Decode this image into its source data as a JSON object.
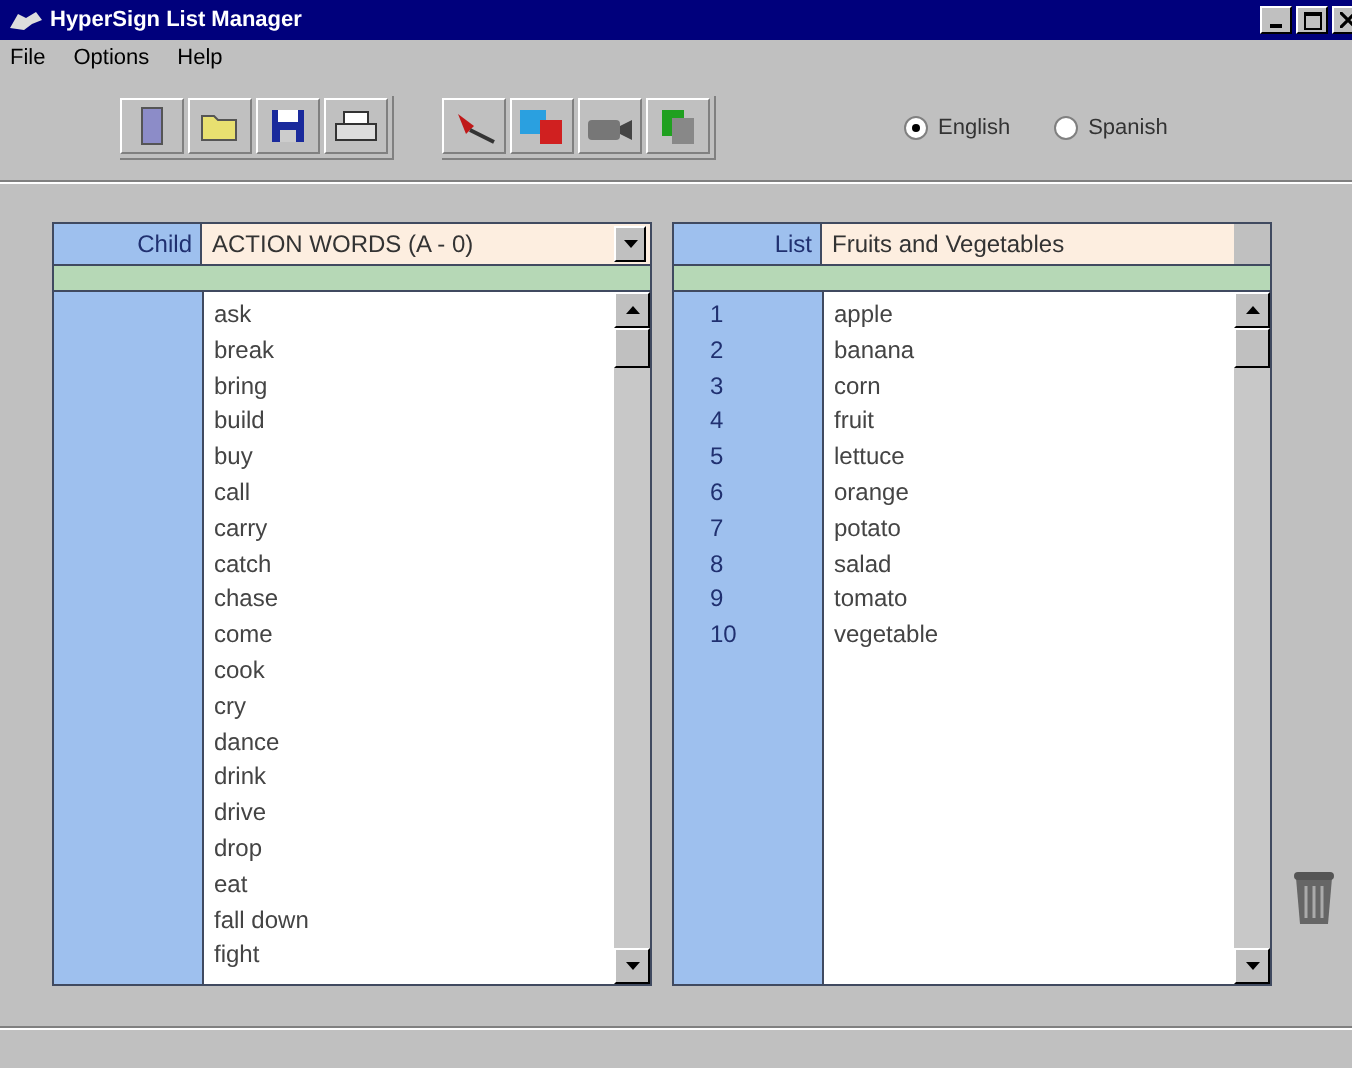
{
  "window": {
    "title": "HyperSign List Manager"
  },
  "menu": [
    {
      "label": "File"
    },
    {
      "label": "Options"
    },
    {
      "label": "Help"
    }
  ],
  "language": [
    {
      "label": "English",
      "selected": true
    },
    {
      "label": "Spanish",
      "selected": false
    }
  ],
  "child_panel": {
    "label": "Child",
    "category": "ACTION WORDS (A - 0)",
    "words": [
      "ask",
      "break",
      "bring",
      "build",
      "buy",
      "call",
      "carry",
      "catch",
      "chase",
      "come",
      "cook",
      "cry",
      "dance",
      "drink",
      "drive",
      "drop",
      "eat",
      "fall down",
      "fight"
    ]
  },
  "list_panel": {
    "label": "List",
    "name": "Fruits and Vegetables",
    "items": [
      {
        "number": "1",
        "word": "apple"
      },
      {
        "number": "2",
        "word": "banana"
      },
      {
        "number": "3",
        "word": "corn"
      },
      {
        "number": "4",
        "word": "fruit"
      },
      {
        "number": "5",
        "word": "lettuce"
      },
      {
        "number": "6",
        "word": "orange"
      },
      {
        "number": "7",
        "word": "potato"
      },
      {
        "number": "8",
        "word": "salad"
      },
      {
        "number": "9",
        "word": "tomato"
      },
      {
        "number": "10",
        "word": "vegetable"
      }
    ]
  }
}
